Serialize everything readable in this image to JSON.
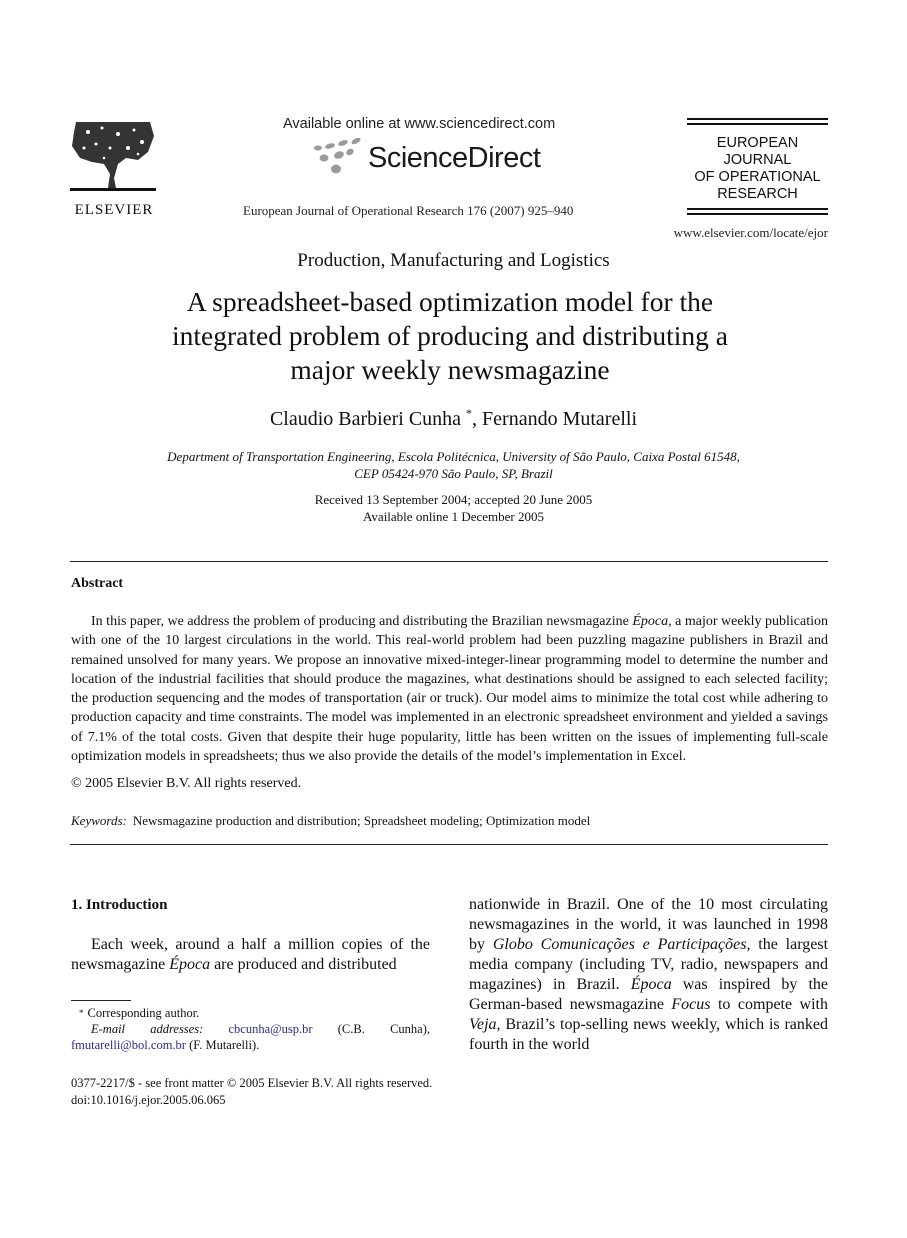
{
  "header": {
    "publisher_logo_text": "ELSEVIER",
    "available_online": "Available online at www.sciencedirect.com",
    "sciencedirect_logo_text": "ScienceDirect",
    "journal_citation": "European Journal of Operational Research 176 (2007) 925–940",
    "journal_logo_lines": [
      "EUROPEAN",
      "JOURNAL",
      "OF OPERATIONAL",
      "RESEARCH"
    ],
    "journal_url": "www.elsevier.com/locate/ejor"
  },
  "article": {
    "section": "Production, Manufacturing and Logistics",
    "title_lines": [
      "A spreadsheet-based optimization model for the",
      "integrated problem of producing and distributing a",
      "major weekly newsmagazine"
    ],
    "authors": {
      "author1": "Claudio Barbieri Cunha",
      "author1_mark": "*",
      "separator": ", ",
      "author2": "Fernando Mutarelli"
    },
    "affiliation_lines": [
      "Department of Transportation Engineering, Escola Politécnica, University of São Paulo, Caixa Postal 61548,",
      "CEP 05424-970 São Paulo, SP, Brazil"
    ],
    "dates": {
      "received": "Received 13 September 2004; accepted 20 June 2005",
      "available": "Available online 1 December 2005"
    }
  },
  "abstract": {
    "heading": "Abstract",
    "text_before_italic": "In this paper, we address the problem of producing and distributing the Brazilian newsmagazine ",
    "italic_term": "Época",
    "text_after_italic": ", a major weekly publication with one of the 10 largest circulations in the world. This real-world problem had been puzzling magazine publishers in Brazil and remained unsolved for many years. We propose an innovative mixed-integer-linear programming model to determine the number and location of the industrial facilities that should produce the magazines, what destinations should be assigned to each selected facility; the production sequencing and the modes of transportation (air or truck). Our model aims to minimize the total cost while adhering to production capacity and time constraints. The model was implemented in an electronic spreadsheet environment and yielded a savings of 7.1% of the total costs. Given that despite their huge popularity, little has been written on the issues of implementing full-scale optimization models in spreadsheets; thus we also provide the details of the model’s implementation in Excel.",
    "copyright": "© 2005 Elsevier B.V. All rights reserved.",
    "keywords_label": "Keywords:",
    "keywords": "Newsmagazine production and distribution; Spreadsheet modeling; Optimization model"
  },
  "introduction": {
    "heading": "1. Introduction",
    "left_p1": "Each week, around a half a million copies of the newsmagazine ",
    "left_italic": "Época",
    "left_p2": " are produced and distributed",
    "right_t1": "nationwide in Brazil. One of the 10 most circulating newsmagazines in the world, it was launched in 1998 by ",
    "right_i1": "Globo Comunicações e Participações",
    "right_t2": ", the largest media company (including TV, radio, newspapers and magazines) in Brazil. ",
    "right_i2": "Época",
    "right_t3": " was inspired by the German-based newsmagazine ",
    "right_i3": "Focus",
    "right_t4": " to compete with ",
    "right_i4": "Veja",
    "right_t5": ", Brazil’s top-selling news weekly, which is ranked fourth in the world"
  },
  "footnote": {
    "mark": "*",
    "corresponding": "Corresponding author.",
    "email_label": "E-mail addresses:",
    "email1": "cbcunha@usp.br",
    "email1_owner": " (C.B. Cunha), ",
    "email2": "fmutarelli@bol.com.br",
    "email2_owner": " (F. Mutarelli)."
  },
  "front_matter": {
    "issn_line": "0377-2217/$ - see front matter © 2005 Elsevier B.V. All rights reserved.",
    "doi": "doi:10.1016/j.ejor.2005.06.065"
  },
  "colors": {
    "text": "#111111",
    "link": "#2b2b8c",
    "logo_gray": "#9a9a9a"
  }
}
